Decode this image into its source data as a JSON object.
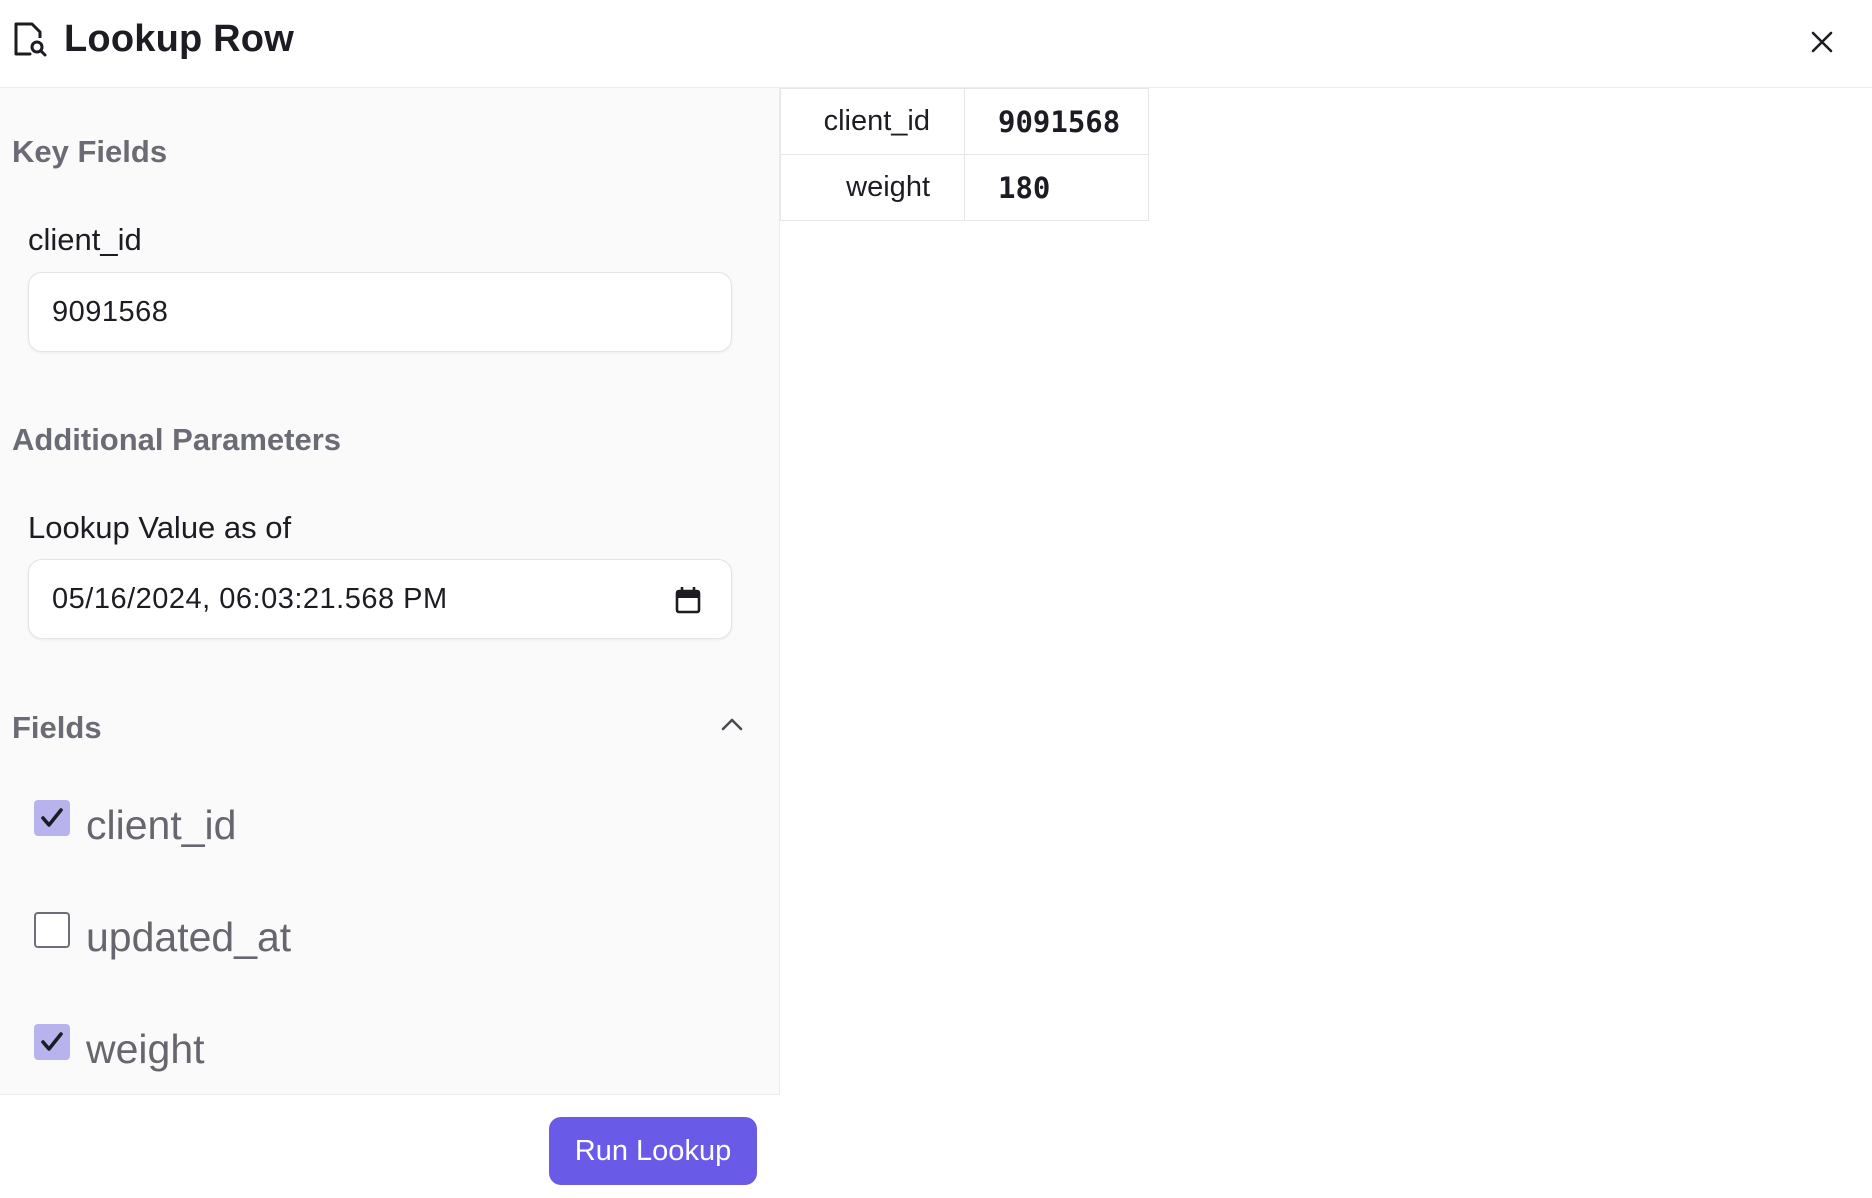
{
  "header": {
    "title": "Lookup Row",
    "icon": "document-search-icon",
    "close_icon": "close-icon"
  },
  "key_fields": {
    "section_title": "Key Fields",
    "fields": [
      {
        "label": "client_id",
        "value": "9091568"
      }
    ]
  },
  "additional_parameters": {
    "section_title": "Additional Parameters",
    "lookup_label": "Lookup Value as of",
    "lookup_value": "05/16/2024, 06:03:21.568 PM",
    "icon": "calendar-icon"
  },
  "fields_section": {
    "section_title": "Fields",
    "expanded": true,
    "items": [
      {
        "label": "client_id",
        "checked": true
      },
      {
        "label": "updated_at",
        "checked": false
      },
      {
        "label": "weight",
        "checked": true
      }
    ]
  },
  "footer": {
    "run_button_label": "Run Lookup",
    "accent_color": "#6a5ae8"
  },
  "result": {
    "rows": [
      {
        "key": "client_id",
        "value": "9091568"
      },
      {
        "key": "weight",
        "value": "180"
      }
    ]
  }
}
